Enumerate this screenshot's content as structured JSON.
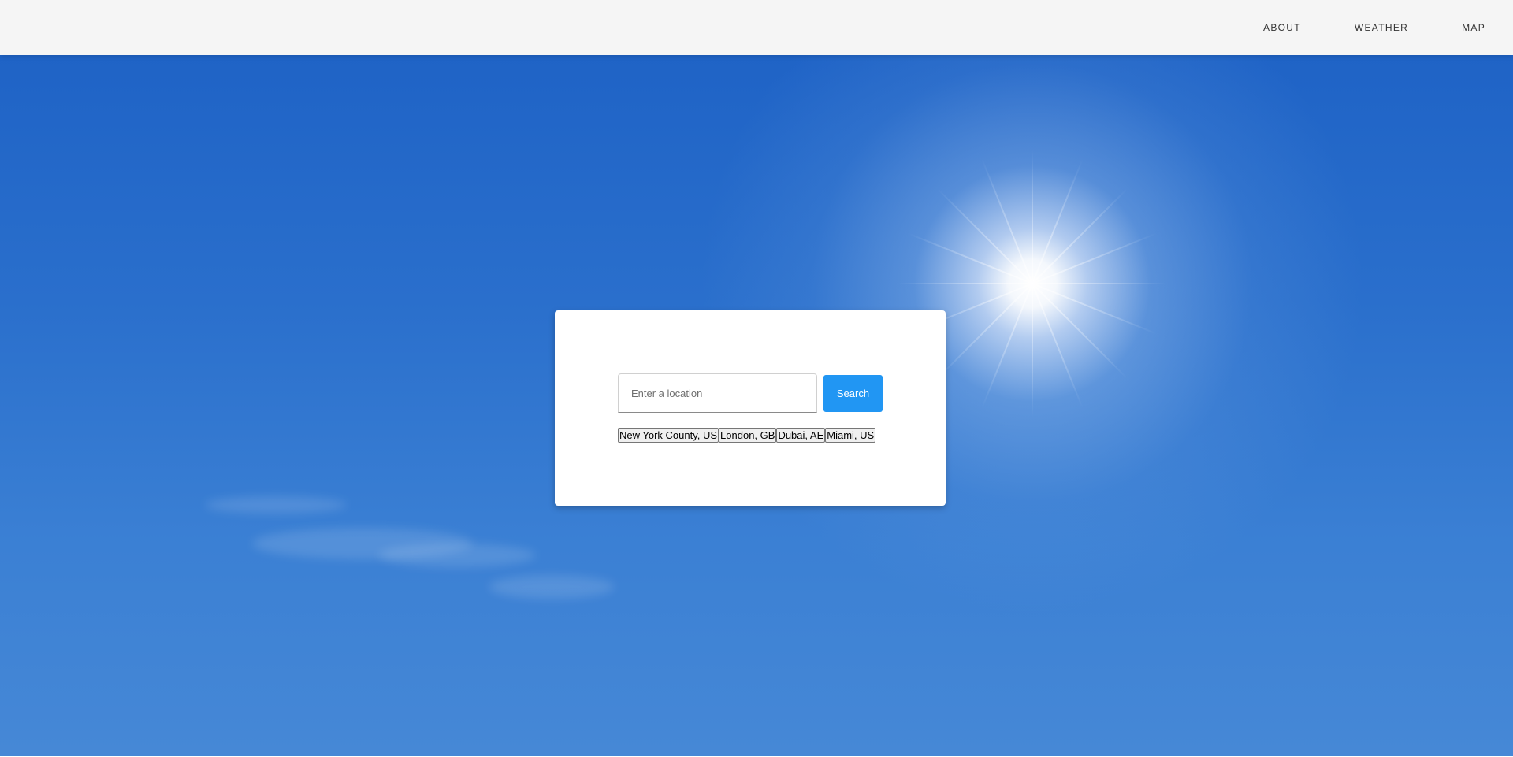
{
  "nav": {
    "items": [
      {
        "label": "ABOUT"
      },
      {
        "label": "WEATHER"
      },
      {
        "label": "MAP"
      }
    ]
  },
  "search": {
    "placeholder": "Enter a location",
    "value": "",
    "button_label": "Search"
  },
  "quick_locations": [
    {
      "label": "New York County, US"
    },
    {
      "label": "London, GB"
    },
    {
      "label": "Dubai, AE"
    },
    {
      "label": "Miami, US"
    }
  ],
  "colors": {
    "topbar": "#f5f5f5",
    "accent": "#2196f3",
    "sky": "#2a6fcc"
  }
}
